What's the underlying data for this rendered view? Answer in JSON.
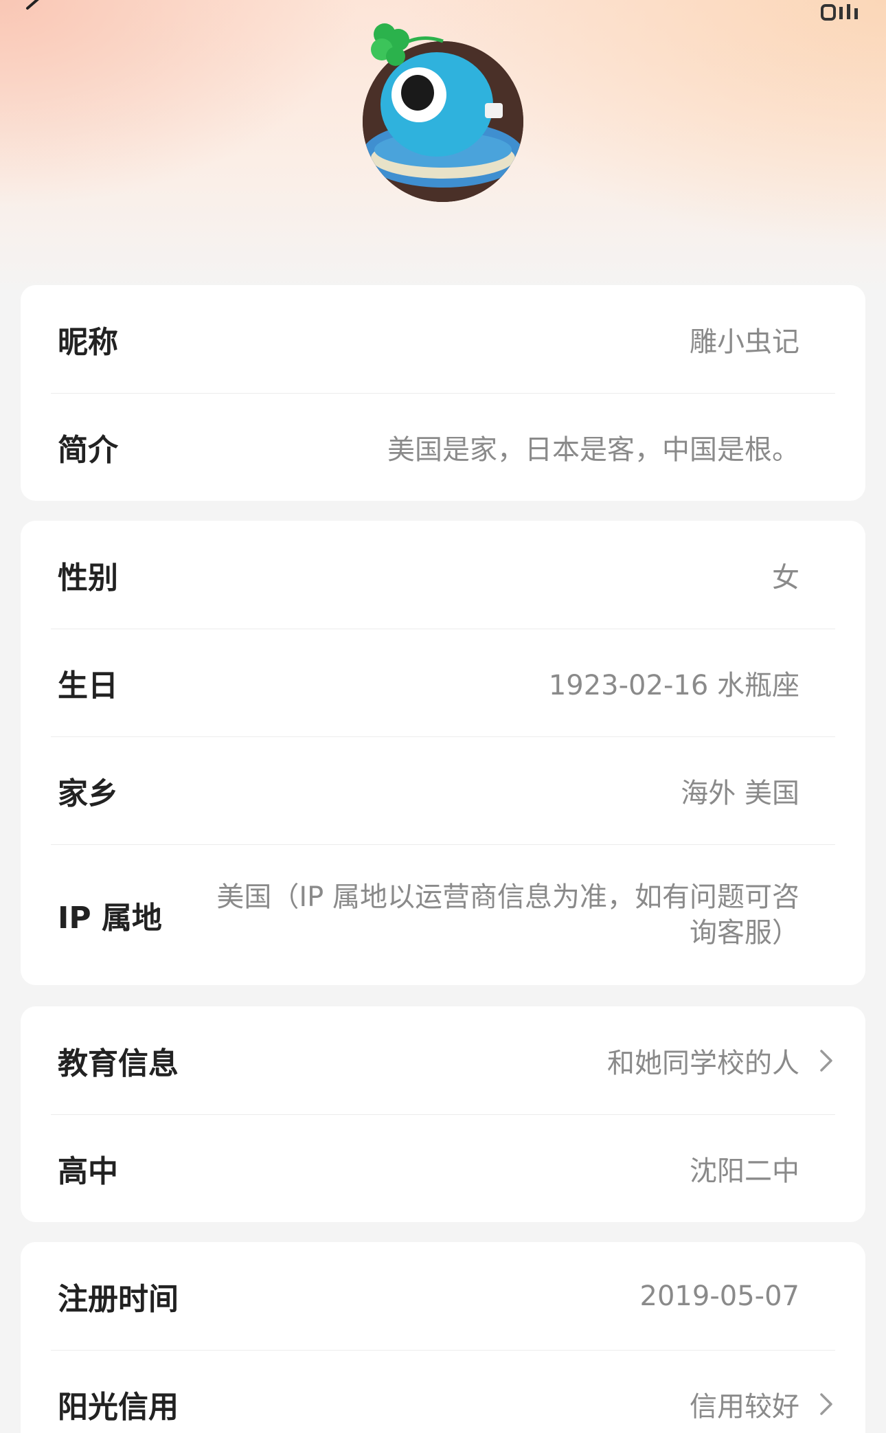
{
  "header": {
    "back_icon": "chevron-left-icon",
    "more_icon": "signal-bars-icon",
    "avatar_icon": "profile-avatar"
  },
  "sections": [
    {
      "rows": [
        {
          "label": "昵称",
          "value": "雕小虫记"
        },
        {
          "label": "简介",
          "value": "美国是家，日本是客，中国是根。"
        }
      ]
    },
    {
      "rows": [
        {
          "label": "性别",
          "value": "女"
        },
        {
          "label": "生日",
          "value": "1923-02-16 水瓶座"
        },
        {
          "label": "家乡",
          "value": "海外 美国"
        },
        {
          "label": "IP 属地",
          "value": "美国（IP 属地以运营商信息为准，如有问题可咨询客服）"
        }
      ]
    },
    {
      "rows": [
        {
          "label": "教育信息",
          "value": "和她同学校的人",
          "chevron": true
        },
        {
          "label": "高中",
          "value": "沈阳二中"
        }
      ]
    },
    {
      "rows": [
        {
          "label": "注册时间",
          "value": "2019-05-07"
        },
        {
          "label": "阳光信用",
          "value": "信用较好",
          "chevron": true
        }
      ]
    }
  ],
  "colors": {
    "label": "#222222",
    "value": "#8a8a8a",
    "card": "#ffffff",
    "page_bg": "#f4f4f4",
    "header_gradient": "#fde5d8"
  }
}
